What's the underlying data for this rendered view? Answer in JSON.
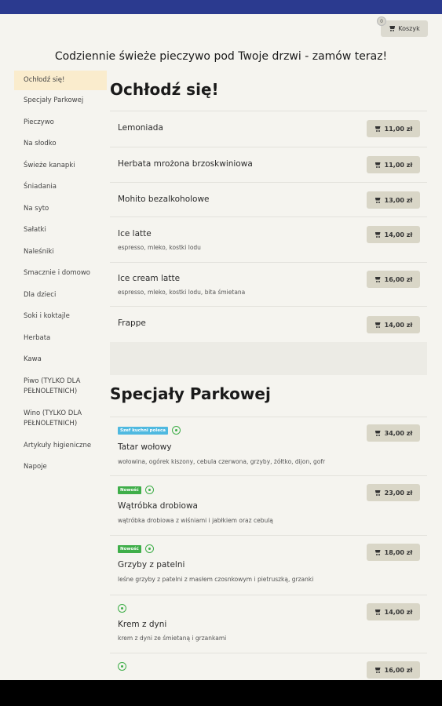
{
  "header": {
    "cart_label": "Koszyk",
    "cart_count": "0",
    "headline": "Codziennie świeże pieczywo pod Twoje drzwi - zamów teraz!"
  },
  "sidebar": {
    "items": [
      {
        "label": "Ochłodź się!",
        "active": true
      },
      {
        "label": "Specjały Parkowej"
      },
      {
        "label": "Pieczywo"
      },
      {
        "label": "Na słodko"
      },
      {
        "label": "Świeże kanapki"
      },
      {
        "label": "Śniadania"
      },
      {
        "label": "Na syto"
      },
      {
        "label": "Sałatki"
      },
      {
        "label": "Naleśniki"
      },
      {
        "label": "Smacznie i domowo"
      },
      {
        "label": "Dla dzieci"
      },
      {
        "label": "Soki i koktajle"
      },
      {
        "label": "Herbata"
      },
      {
        "label": "Kawa"
      },
      {
        "label": "Piwo (TYLKO DLA PEŁNOLETNICH)"
      },
      {
        "label": "Wino (TYLKO DLA PEŁNOLETNICH)"
      },
      {
        "label": "Artykuły higieniczne"
      },
      {
        "label": "Napoje"
      }
    ]
  },
  "sections": [
    {
      "title": "Ochłodź się!",
      "items": [
        {
          "name": "Lemoniada",
          "desc": "",
          "price": "11,00 zł"
        },
        {
          "name": "Herbata mrożona brzoskwiniowa",
          "desc": "",
          "price": "11,00 zł"
        },
        {
          "name": "Mohito bezalkoholowe",
          "desc": "",
          "price": "13,00 zł"
        },
        {
          "name": "Ice latte",
          "desc": "espresso, mleko, kostki lodu",
          "price": "14,00 zł"
        },
        {
          "name": "Ice cream latte",
          "desc": "espresso, mleko, kostki lodu, bita śmietana",
          "price": "16,00 zł"
        },
        {
          "name": "Frappe",
          "desc": "",
          "price": "14,00 zł"
        }
      ]
    },
    {
      "title": "Specjały Parkowej",
      "items": [
        {
          "name": "Tatar wołowy",
          "badge": "Szef kuchni poleca",
          "desc": "wołowina, ogórek kiszony, cebula czerwona, grzyby, żółtko, dijon, gofr",
          "price": "34,00 zł"
        },
        {
          "name": "Wątróbka drobiowa",
          "badge": "Nowość",
          "desc": "wątróbka drobiowa z wiśniami i jabłkiem oraz cebulą",
          "price": "23,00 zł"
        },
        {
          "name": "Grzyby z patelni",
          "badge": "Nowość",
          "desc": "leśne grzyby z patelni z masłem czosnkowym i pietruszką, grzanki",
          "price": "18,00 zł"
        },
        {
          "name": "Krem z dyni",
          "desc": "krem z dyni ze śmietaną i grzankami",
          "price": "14,00 zł"
        },
        {
          "name": "",
          "desc": "",
          "price": "16,00 zł"
        }
      ]
    }
  ],
  "colors": {
    "topbar": "#2b3a8f",
    "background": "#f5f4ef",
    "price_button": "#d9d6c7",
    "active_sidebar": "#faeccd",
    "chef_badge": "#4fb9e0",
    "new_badge": "#3fae49"
  }
}
